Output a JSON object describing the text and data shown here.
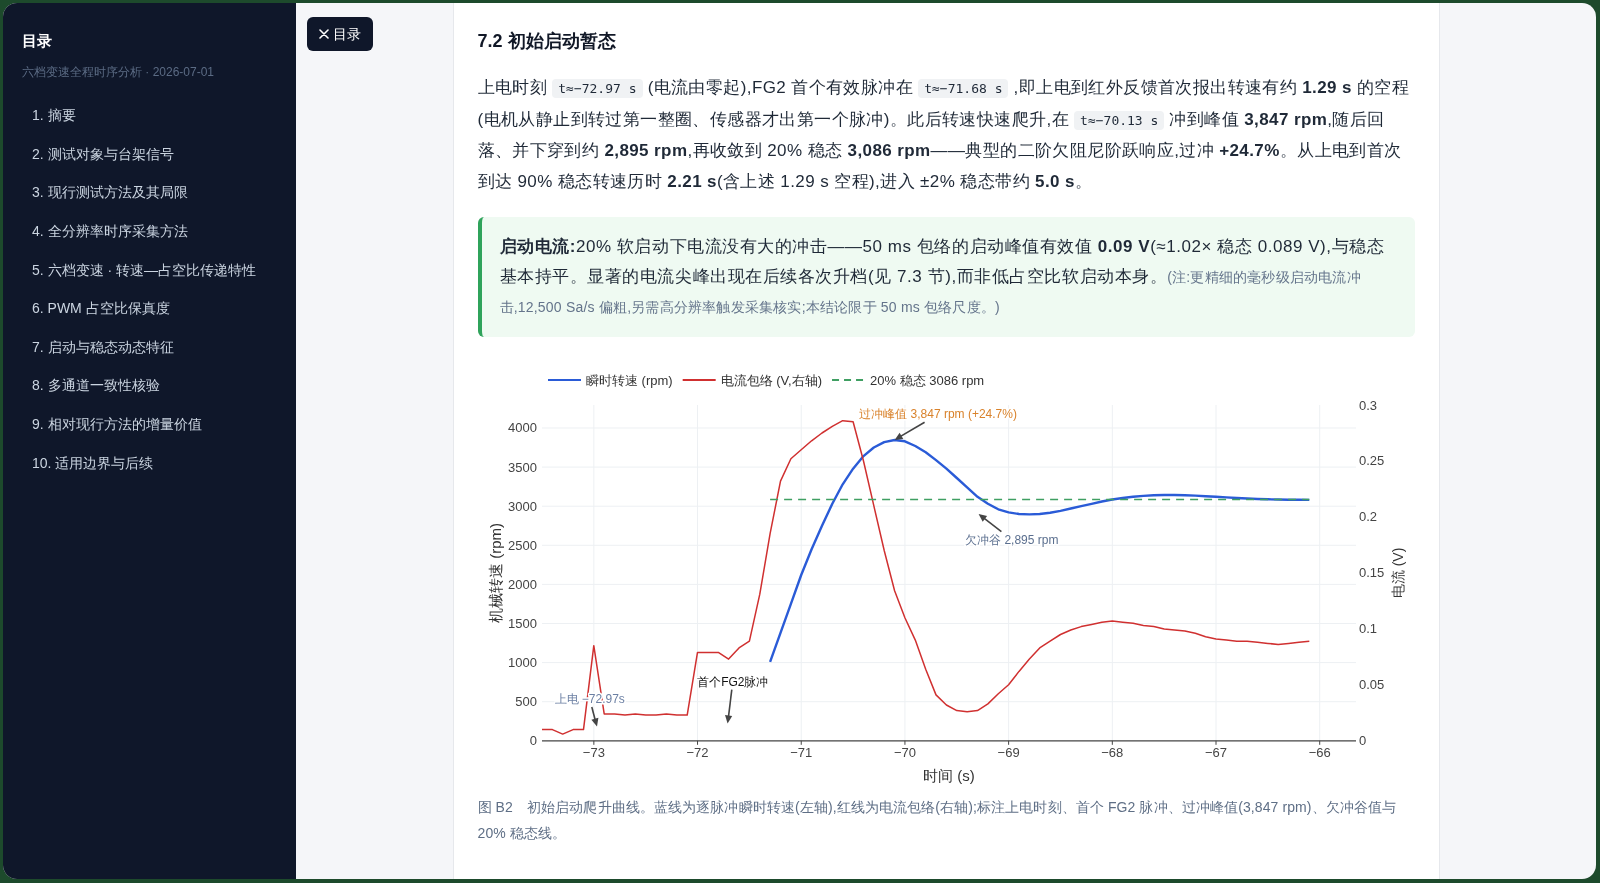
{
  "sidebar": {
    "title": "目录",
    "subtitle": "六档变速全程时序分析 · 2026-07-01",
    "items": [
      "1. 摘要",
      "2. 测试对象与台架信号",
      "3. 现行测试方法及其局限",
      "4. 全分辨率时序采集方法",
      "5. 六档变速 · 转速—占空比传递特性",
      "6. PWM 占空比保真度",
      "7. 启动与稳态动态特征",
      "8. 多通道一致性核验",
      "9. 相对现行方法的增量价值",
      "10. 适用边界与后续"
    ]
  },
  "toc_toggle": {
    "label": "目录"
  },
  "section": {
    "heading": "7.2 初始启动暂态",
    "paragraph": [
      {
        "kind": "text",
        "text": "上电时刻 "
      },
      {
        "kind": "code",
        "text": "t≈−72.97 s"
      },
      {
        "kind": "text",
        "text": " (电流由零起),FG2 首个有效脉冲在 "
      },
      {
        "kind": "code",
        "text": "t≈−71.68 s"
      },
      {
        "kind": "text",
        "text": " ,即上电到红外反馈首次报出转速有约 **1.29 s** 的空程(电机从静止到转过第一整圈、传感器才出第一个脉冲)。此后转速快速爬升,在 "
      },
      {
        "kind": "code",
        "text": "t≈−70.13 s"
      },
      {
        "kind": "text",
        "text": " 冲到峰值 **3,847 rpm**,随后回落、并下穿到约 **2,895 rpm**,再收敛到 20% 稳态 **3,086 rpm**——典型的二阶欠阻尼阶跃响应,过冲 **+24.7%**。从上电到首次到达 90% 稳态转速历时 **2.21 s**(含上述 1.29 s 空程),进入 ±2% 稳态带约 **5.0 s**。"
      }
    ],
    "callout": [
      {
        "kind": "text",
        "text": "**启动电流:**20% 软启动下电流没有大的冲击——50 ms 包络的启动峰值有效值 **0.09 V**(≈1.02× 稳态 0.089 V),与稳态基本持平。显著的电流尖峰出现在后续各次升档(见 7.3 节),而非低占空比软启动本身。"
      },
      {
        "kind": "note",
        "text": "(注:更精细的毫秒级启动电流冲击,12,500 Sa/s 偏粗,另需高分辨率触发采集核实;本结论限于 50 ms 包络尺度。)"
      }
    ],
    "figure": {
      "chart_data": {
        "type": "line",
        "xlabel": "时间 (s)",
        "ylabel": "机械转速 (rpm)",
        "y2label": "电流 (V)",
        "grid": true,
        "legend": "top",
        "x": [
          -73.5,
          -73.4,
          -73.3,
          -73.2,
          -73.1,
          -73,
          -72.9,
          -72.8,
          -72.7,
          -72.6,
          -72.5,
          -72.4,
          -72.3,
          -72.2,
          -72.1,
          -72,
          -71.9,
          -71.8,
          -71.7,
          -71.6,
          -71.5,
          -71.4,
          -71.3,
          -71.2,
          -71.1,
          -71,
          -70.9,
          -70.8,
          -70.7,
          -70.6,
          -70.5,
          -70.4,
          -70.3,
          -70.2,
          -70.1,
          -70,
          -69.9,
          -69.8,
          -69.7,
          -69.6,
          -69.5,
          -69.4,
          -69.3,
          -69.2,
          -69.1,
          -69,
          -68.9,
          -68.8,
          -68.7,
          -68.6,
          -68.5,
          -68.4,
          -68.3,
          -68.2,
          -68.1,
          -68,
          -67.9,
          -67.8,
          -67.7,
          -67.6,
          -67.5,
          -67.4,
          -67.3,
          -67.2,
          -67.1,
          -67,
          -66.9,
          -66.8,
          -66.7,
          -66.6,
          -66.5,
          -66.4,
          -66.3,
          -66.2,
          -66.1
        ],
        "series": [
          {
            "name": "瞬时转速 (rpm)",
            "color": "#2a5bd7",
            "values": [
              null,
              null,
              null,
              null,
              null,
              null,
              null,
              null,
              null,
              null,
              null,
              null,
              null,
              null,
              null,
              null,
              null,
              null,
              null,
              null,
              null,
              null,
              1010,
              1380,
              1750,
              2120,
              2450,
              2750,
              3030,
              3280,
              3480,
              3640,
              3750,
              3820,
              3847,
              3830,
              3770,
              3690,
              3590,
              3480,
              3360,
              3240,
              3120,
              3030,
              2960,
              2920,
              2900,
              2895,
              2900,
              2915,
              2940,
              2970,
              3000,
              3030,
              3060,
              3085,
              3105,
              3120,
              3132,
              3140,
              3143,
              3143,
              3140,
              3135,
              3128,
              3120,
              3112,
              3105,
              3098,
              3092,
              3088,
              3085,
              3083,
              3082,
              3080
            ]
          },
          {
            "name": "电流包络 (V,右轴)",
            "color": "#d03030",
            "axis": "y2",
            "values": [
              0.01,
              0.01,
              0.006,
              0.01,
              0.01,
              0.085,
              0.024,
              0.024,
              0.023,
              0.024,
              0.023,
              0.023,
              0.024,
              0.023,
              0.023,
              0.079,
              0.079,
              0.079,
              0.073,
              0.083,
              0.089,
              0.131,
              0.185,
              0.232,
              0.252,
              0.26,
              0.268,
              0.275,
              0.281,
              0.286,
              0.285,
              0.25,
              0.21,
              0.17,
              0.134,
              0.11,
              0.09,
              0.064,
              0.041,
              0.032,
              0.027,
              0.026,
              0.027,
              0.033,
              0.042,
              0.05,
              0.062,
              0.073,
              0.083,
              0.089,
              0.095,
              0.099,
              0.102,
              0.104,
              0.106,
              0.107,
              0.106,
              0.105,
              0.103,
              0.102,
              0.1,
              0.099,
              0.098,
              0.096,
              0.093,
              0.091,
              0.09,
              0.089,
              0.089,
              0.088,
              0.087,
              0.086,
              0.087,
              0.088,
              0.089
            ]
          },
          {
            "name": "20% 稳态 3086 rpm",
            "color": "#3f9f62",
            "line_style": "dashed",
            "values": [
              null,
              null,
              null,
              null,
              null,
              null,
              null,
              null,
              null,
              null,
              null,
              null,
              null,
              null,
              null,
              null,
              null,
              null,
              null,
              null,
              null,
              null,
              3086,
              3086,
              3086,
              3086,
              3086,
              3086,
              3086,
              3086,
              3086,
              3086,
              3086,
              3086,
              3086,
              3086,
              3086,
              3086,
              3086,
              3086,
              3086,
              3086,
              3086,
              3086,
              3086,
              3086,
              3086,
              3086,
              3086,
              3086,
              3086,
              3086,
              3086,
              3086,
              3086,
              3086,
              3086,
              3086,
              3086,
              3086,
              3086,
              3086,
              3086,
              3086,
              3086,
              3086,
              3086,
              3086,
              3086,
              3086,
              3086,
              3086,
              3086,
              3086,
              3086
            ]
          }
        ],
        "xlim": [
          -73.5,
          -65.65
        ],
        "ylim": [
          0,
          4294
        ],
        "y2lim": [
          0,
          0.3
        ],
        "xticks": [
          {
            "value": -73,
            "label": "−73"
          },
          {
            "value": -72,
            "label": "−72"
          },
          {
            "value": -71,
            "label": "−71"
          },
          {
            "value": -70,
            "label": "−70"
          },
          {
            "value": -69,
            "label": "−69"
          },
          {
            "value": -68,
            "label": "−68"
          },
          {
            "value": -67,
            "label": "−67"
          },
          {
            "value": -66,
            "label": "−66"
          }
        ],
        "yticks": [
          0,
          500,
          1000,
          1500,
          2000,
          2500,
          3000,
          3500,
          4000
        ],
        "y2ticks": [
          0,
          0.05,
          0.1,
          0.15,
          0.2,
          0.25,
          0.3
        ],
        "annotations": [
          {
            "text": "过冲峰值 3,847 rpm (+24.7%)",
            "x": -70.1,
            "y": 3847
          },
          "欠冲谷 2,895 rpm",
          "上电 −72.97s",
          "首个FG2脉冲"
        ]
      },
      "caption": "图 B2　初始启动爬升曲线。蓝线为逐脉冲瞬时转速(左轴),红线为电流包络(右轴);标注上电时刻、首个 FG2 脉冲、过冲峰值(3,847 rpm)、欠冲谷值与 20% 稳态线。"
    }
  }
}
